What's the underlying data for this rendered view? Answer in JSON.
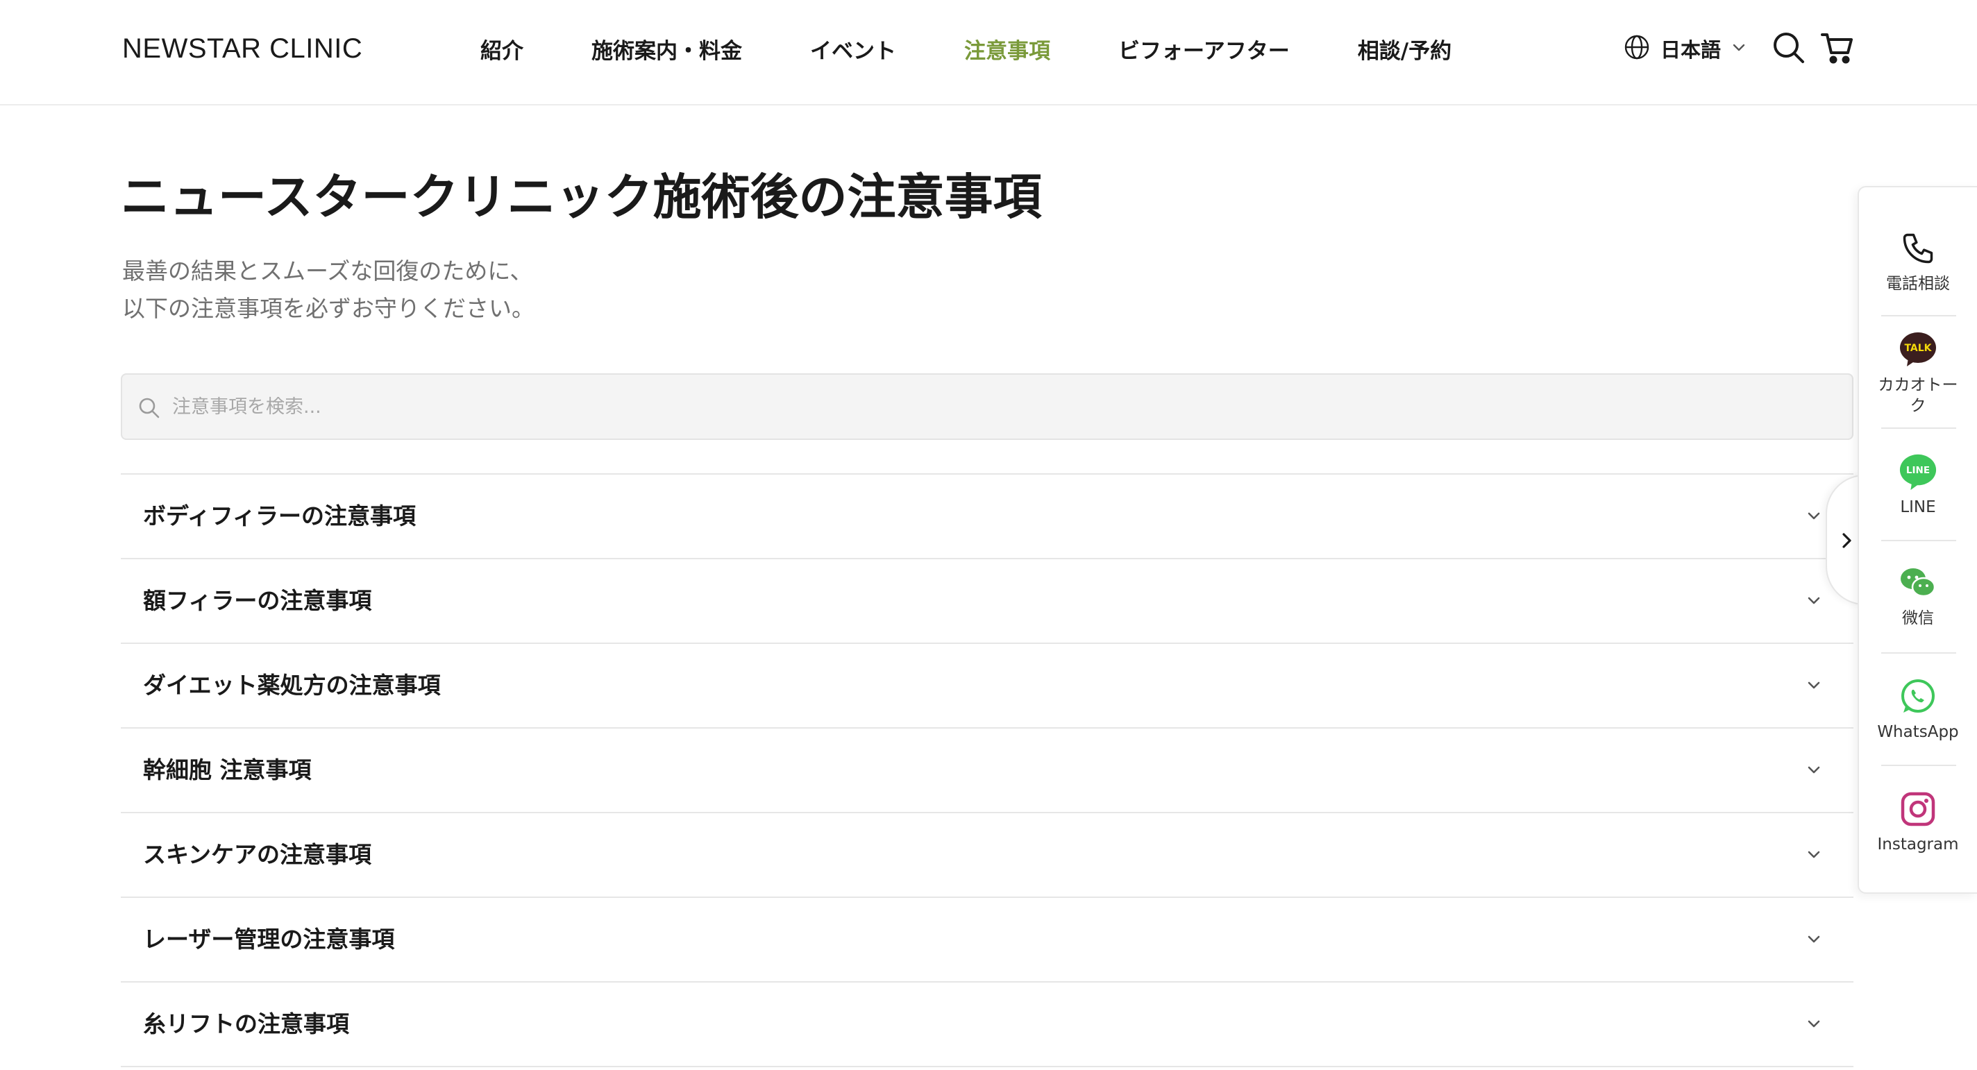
{
  "header": {
    "logo": "NEWSTAR CLINIC",
    "nav": [
      {
        "label": "紹介"
      },
      {
        "label": "施術案内・料金"
      },
      {
        "label": "イベント"
      },
      {
        "label": "注意事項"
      },
      {
        "label": "ビフォーアフター"
      },
      {
        "label": "相談/予約"
      }
    ],
    "active_nav": "注意事項",
    "language": "日本語",
    "icons": [
      "globe-icon",
      "chevron-down-icon",
      "search-icon",
      "cart-icon"
    ]
  },
  "main": {
    "title": "ニュースタークリニック施術後の注意事項",
    "subtitle_line1": "最善の結果とスムーズな回復のために、",
    "subtitle_line2": "以下の注意事項を必ずお守りください。",
    "search": {
      "placeholder": "注意事項を検索...",
      "value": ""
    },
    "accordion": [
      {
        "label": "ボディフィラーの注意事項"
      },
      {
        "label": "額フィラーの注意事項"
      },
      {
        "label": "ダイエット薬処方の注意事項"
      },
      {
        "label": "幹細胞 注意事項"
      },
      {
        "label": "スキンケアの注意事項"
      },
      {
        "label": "レーザー管理の注意事項"
      },
      {
        "label": "糸リフトの注意事項"
      }
    ]
  },
  "side_panel": {
    "items": [
      {
        "label": "電話相談",
        "icon": "phone-icon"
      },
      {
        "label": "カカオトーク",
        "icon": "kakaotalk-icon",
        "badge": "TALK"
      },
      {
        "label": "LINE",
        "icon": "line-icon",
        "badge": "LINE"
      },
      {
        "label": "微信",
        "icon": "wechat-icon"
      },
      {
        "label": "WhatsApp",
        "icon": "whatsapp-icon"
      },
      {
        "label": "Instagram",
        "icon": "instagram-icon"
      }
    ],
    "toggle_icon": "chevron-right-icon"
  },
  "colors": {
    "accent_green": "#7a9a3a",
    "line_green": "#3ec75a",
    "kakao_brown": "#3b1e1e",
    "kakao_yellow": "#f5d90a",
    "instagram": "#c0357a"
  }
}
